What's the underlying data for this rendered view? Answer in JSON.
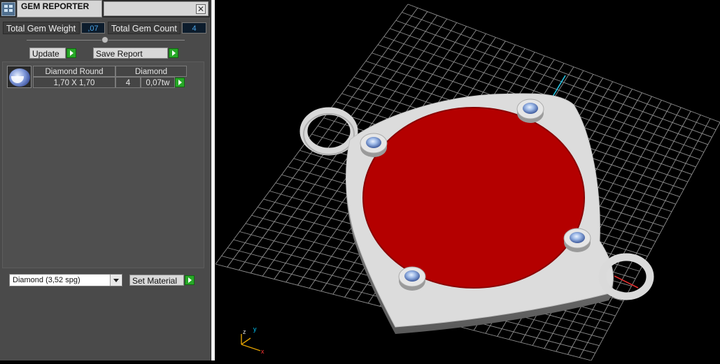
{
  "panel": {
    "title": "GEM REPORTER",
    "close_glyph": "✕",
    "total_weight_label": "Total Gem Weight",
    "total_weight_value": ",07",
    "total_count_label": "Total Gem Count",
    "total_count_value": "4",
    "update_label": "Update",
    "save_report_label": "Save Report",
    "gem_row": {
      "name": "Diamond Round",
      "material": "Diamond",
      "size": "1,70 X 1,70",
      "count": "4",
      "weight": "0,07tw"
    },
    "material_select": "Diamond     (3,52 spg)",
    "set_material_label": "Set Material"
  },
  "viewport": {
    "axis_x": "x",
    "axis_y": "y",
    "axis_z": "z"
  },
  "colors": {
    "panel_bg": "#4a4a4a",
    "accent_green": "#27a827",
    "face_red": "#b40000",
    "metal": "#d9d9d9",
    "grid": "#8a8a8a"
  }
}
